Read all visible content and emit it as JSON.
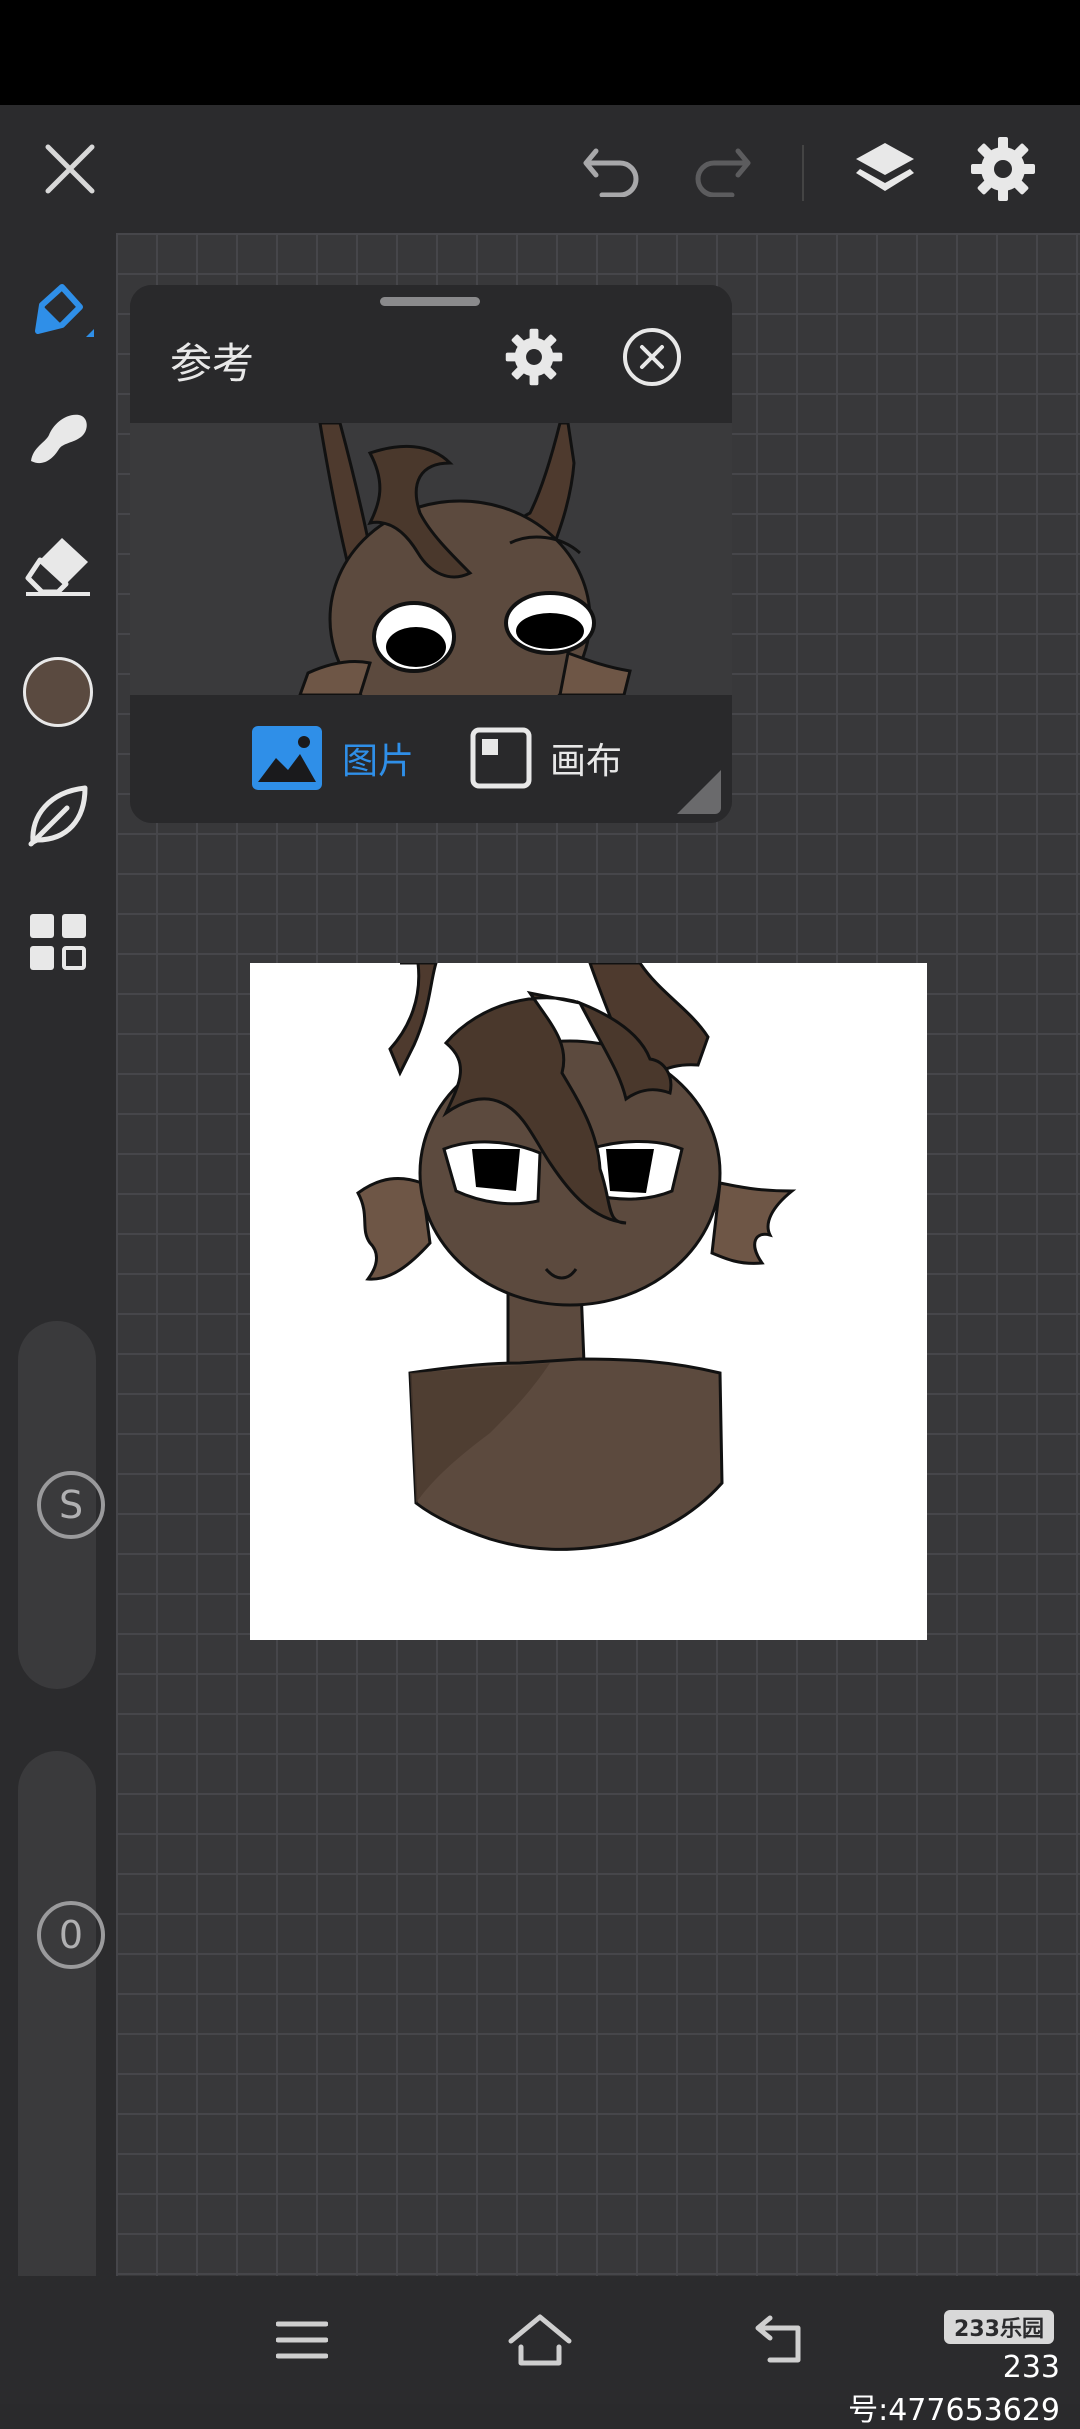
{
  "app": {
    "accent_color": "#2f8fe8",
    "current_color": "#5a4a40"
  },
  "top_toolbar": {
    "close_icon": "close-icon",
    "undo_icon": "undo-icon",
    "redo_icon": "redo-icon",
    "layers_icon": "layers-icon",
    "settings_icon": "gear-icon"
  },
  "left_toolbar": {
    "tools": [
      "pen-tool",
      "smudge-tool",
      "eraser-tool",
      "color-swatch",
      "leaf-tool",
      "grid-tool"
    ],
    "size_slider": {
      "label": "S"
    },
    "opacity_slider": {
      "label": "0"
    }
  },
  "reference_panel": {
    "title": "参考",
    "tab_picture": "图片",
    "tab_canvas": "画布",
    "selected_tab": "图片"
  },
  "nav_bar": {
    "menu_icon": "menu-icon",
    "home_icon": "home-icon",
    "back_icon": "back-icon"
  },
  "watermark": {
    "badge": "233乐园",
    "text": "233号:477653629"
  }
}
